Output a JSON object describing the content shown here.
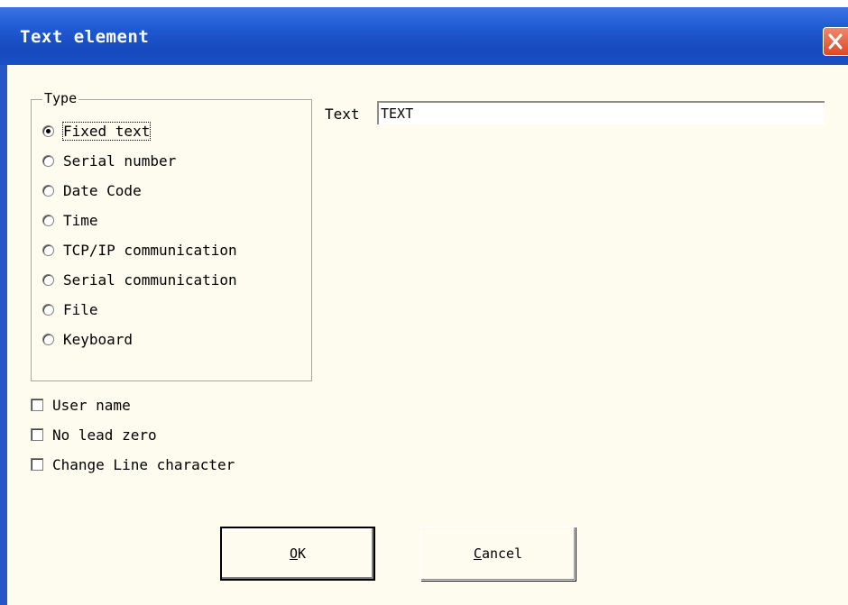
{
  "window": {
    "title": "Text element"
  },
  "type_group": {
    "legend": "Type",
    "options": [
      {
        "label": "Fixed text",
        "checked": true
      },
      {
        "label": "Serial number",
        "checked": false
      },
      {
        "label": "Date Code",
        "checked": false
      },
      {
        "label": "Time",
        "checked": false
      },
      {
        "label": "TCP/IP communication",
        "checked": false
      },
      {
        "label": "Serial communication",
        "checked": false
      },
      {
        "label": "File",
        "checked": false
      },
      {
        "label": "Keyboard",
        "checked": false
      }
    ]
  },
  "checkboxes": [
    {
      "label": "User name",
      "checked": false
    },
    {
      "label": "No lead zero",
      "checked": false
    },
    {
      "label": "Change Line character",
      "checked": false
    }
  ],
  "text_field": {
    "label": "Text",
    "value": "TEXT"
  },
  "buttons": {
    "ok": {
      "mnemonic": "O",
      "rest": "K"
    },
    "cancel": {
      "mnemonic": "C",
      "rest": "ancel"
    }
  },
  "colors": {
    "titlebar": "#1f5bd3",
    "client_bg": "#fefbef",
    "close": "#d94a26"
  }
}
